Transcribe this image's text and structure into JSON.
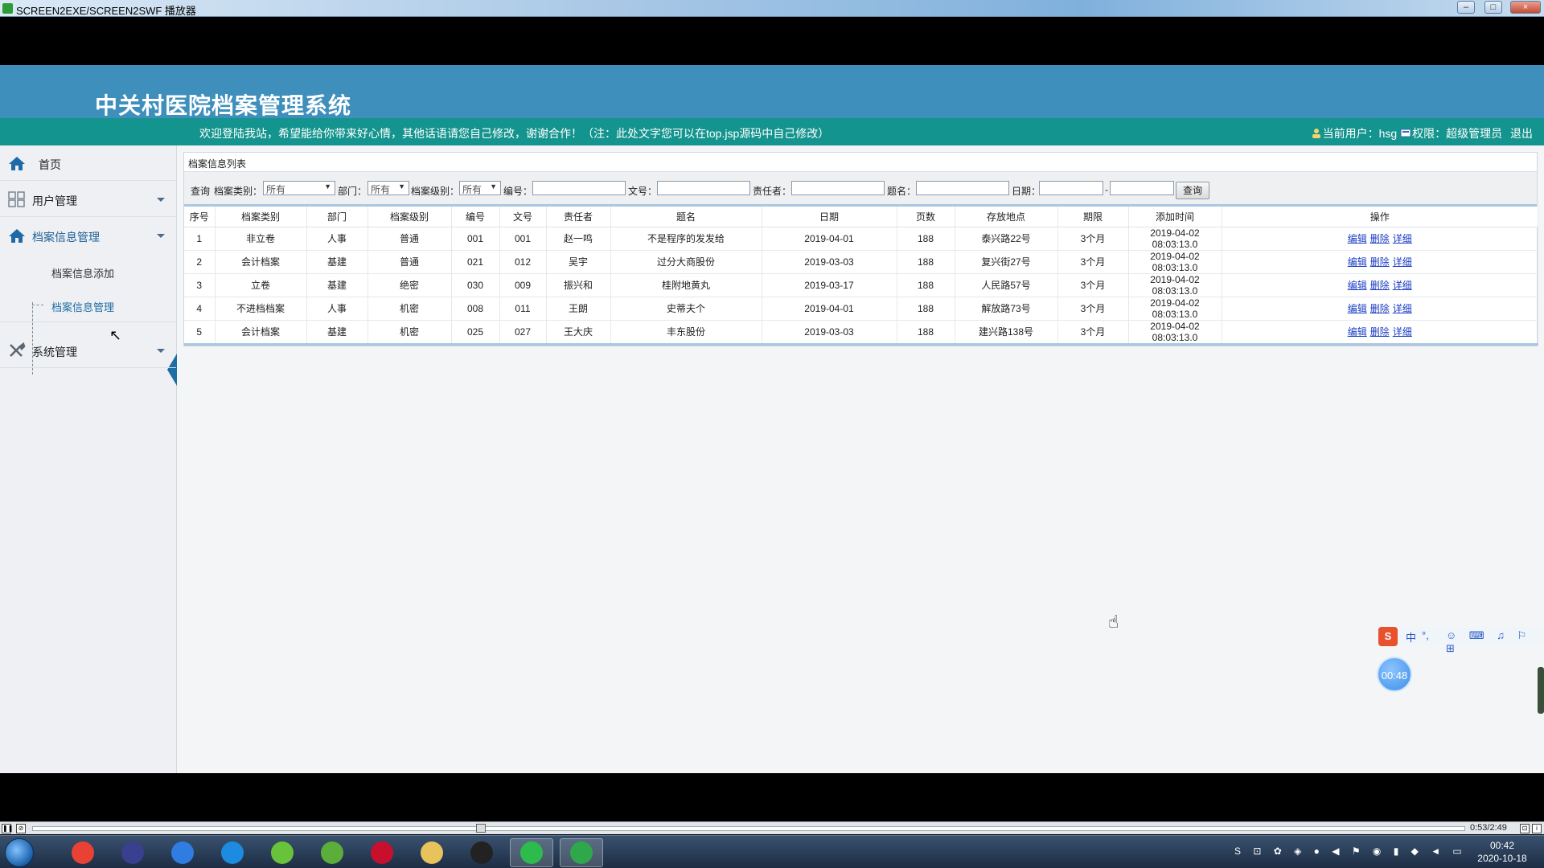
{
  "window": {
    "title": "SCREEN2EXE/SCREEN2SWF 播放器",
    "min": "–",
    "max": "□",
    "close": "×"
  },
  "header": {
    "title": "中关村医院档案管理系统",
    "welcome": "欢迎登陆我站，希望能给你带来好心情，其他话语请您自己修改，谢谢合作！（注：此处文字您可以在top.jsp源码中自己修改）",
    "user_label": "当前用户：hsg",
    "role_label": "权限：超级管理员",
    "logout": "退出"
  },
  "sidebar": {
    "home": "首页",
    "user_mgmt": "用户管理",
    "archive_mgmt": "档案信息管理",
    "sub_add": "档案信息添加",
    "sub_manage": "档案信息管理",
    "system_mgmt": "系统管理"
  },
  "panel": {
    "title": "档案信息列表"
  },
  "search": {
    "query_label": "查询",
    "category_label": "档案类别：",
    "category_value": "所有",
    "dept_label": "部门：",
    "dept_value": "所有",
    "level_label": "档案级别：",
    "level_value": "所有",
    "number_label": "编号：",
    "doc_label": "文号：",
    "owner_label": "责任者：",
    "name_label": "题名：",
    "date_label": "日期：",
    "date_sep": "-",
    "button": "查询"
  },
  "table": {
    "columns": [
      "序号",
      "档案类别",
      "部门",
      "档案级别",
      "编号",
      "文号",
      "责任者",
      "题名",
      "日期",
      "页数",
      "存放地点",
      "期限",
      "添加时间",
      "操作"
    ],
    "actions": [
      "编辑",
      "删除",
      "详细"
    ],
    "rows": [
      [
        "1",
        "非立卷",
        "人事",
        "普通",
        "001",
        "001",
        "赵一鸣",
        "不是程序的发发给",
        "2019-04-01",
        "188",
        "泰兴路22号",
        "3个月",
        "2019-04-02 08:03:13.0"
      ],
      [
        "2",
        "会计档案",
        "基建",
        "普通",
        "021",
        "012",
        "吴宇",
        "过分大商股份",
        "2019-03-03",
        "188",
        "复兴街27号",
        "3个月",
        "2019-04-02 08:03:13.0"
      ],
      [
        "3",
        "立卷",
        "基建",
        "绝密",
        "030",
        "009",
        "振兴和",
        "桂附地黄丸",
        "2019-03-17",
        "188",
        "人民路57号",
        "3个月",
        "2019-04-02 08:03:13.0"
      ],
      [
        "4",
        "不进档档案",
        "人事",
        "机密",
        "008",
        "011",
        "王朗",
        "史蒂夫个",
        "2019-04-01",
        "188",
        "解放路73号",
        "3个月",
        "2019-04-02 08:03:13.0"
      ],
      [
        "5",
        "会计档案",
        "基建",
        "机密",
        "025",
        "027",
        "王大庆",
        "丰东股份",
        "2019-03-03",
        "188",
        "建兴路138号",
        "3个月",
        "2019-04-02 08:03:13.0"
      ]
    ]
  },
  "player": {
    "time": "0:53/2:49",
    "progress": 0.31
  },
  "ime": {
    "logo": "S",
    "mode": "中",
    "punct": "°,",
    "tools": "☺ ⌨ ♫ ⚐ ⊞"
  },
  "timer": {
    "value": "00:48"
  },
  "taskbar": {
    "clock_time": "00:42",
    "clock_date": "2020-10-18",
    "apps": [
      {
        "name": "chrome-icon",
        "color": "#e94235"
      },
      {
        "name": "eclipse-icon",
        "color": "#3a3f8f"
      },
      {
        "name": "baidu-netdisk-icon",
        "color": "#2f7de1"
      },
      {
        "name": "browser-icon",
        "color": "#1c8be0"
      },
      {
        "name": "leaf-app-icon",
        "color": "#69c33a"
      },
      {
        "name": "notepad-icon",
        "color": "#5cae3a"
      },
      {
        "name": "flash-icon",
        "color": "#c8102e"
      },
      {
        "name": "folder-icon",
        "color": "#e8c25b"
      },
      {
        "name": "qq-icon",
        "color": "#222222"
      },
      {
        "name": "wechat-icon",
        "color": "#2dbb4e"
      },
      {
        "name": "player-icon",
        "color": "#2ea84a"
      }
    ],
    "tray": "S ⊡ ✿ ◈ ● ◀ ⚑ ◉ ▮ ◆ ◄ ▭"
  }
}
